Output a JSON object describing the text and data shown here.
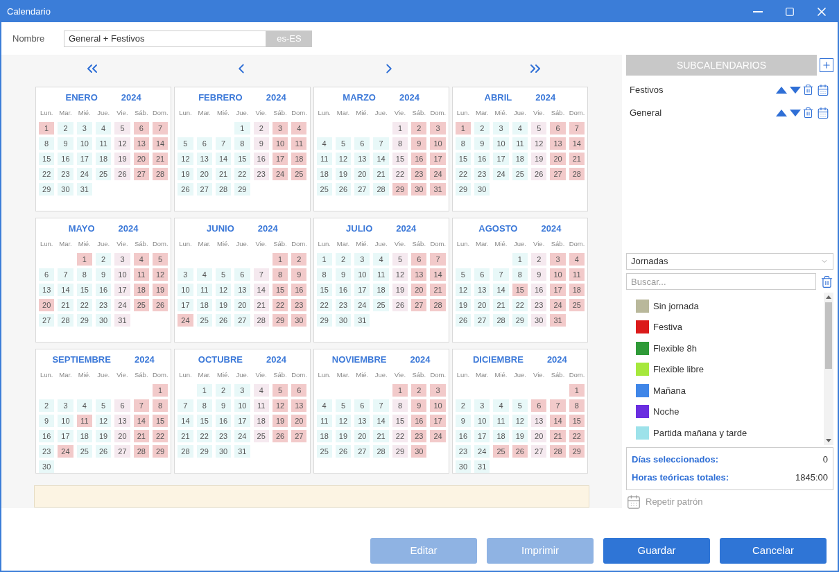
{
  "window": {
    "title": "Calendario"
  },
  "name_field": {
    "label": "Nombre",
    "value": "General + Festivos",
    "locale": "es-ES"
  },
  "months": [
    {
      "name": "ENERO",
      "year": "2024",
      "weekdays": [
        "Lun.",
        "Mar.",
        "Mié.",
        "Jue.",
        "Vie.",
        "Sáb.",
        "Dom."
      ],
      "days": [
        {
          "n": "1",
          "kind": "h"
        },
        {
          "n": "2",
          "kind": "w"
        },
        {
          "n": "3",
          "kind": "w"
        },
        {
          "n": "4",
          "kind": "w"
        },
        {
          "n": "5",
          "kind": "f"
        },
        {
          "n": "6",
          "kind": "h"
        },
        {
          "n": "7",
          "kind": "h"
        },
        {
          "n": "8",
          "kind": "w"
        },
        {
          "n": "9",
          "kind": "w"
        },
        {
          "n": "10",
          "kind": "w"
        },
        {
          "n": "11",
          "kind": "w"
        },
        {
          "n": "12",
          "kind": "f"
        },
        {
          "n": "13",
          "kind": "h"
        },
        {
          "n": "14",
          "kind": "h"
        },
        {
          "n": "15",
          "kind": "w"
        },
        {
          "n": "16",
          "kind": "w"
        },
        {
          "n": "17",
          "kind": "w"
        },
        {
          "n": "18",
          "kind": "w"
        },
        {
          "n": "19",
          "kind": "f"
        },
        {
          "n": "20",
          "kind": "h"
        },
        {
          "n": "21",
          "kind": "h"
        },
        {
          "n": "22",
          "kind": "w"
        },
        {
          "n": "23",
          "kind": "w"
        },
        {
          "n": "24",
          "kind": "w"
        },
        {
          "n": "25",
          "kind": "w"
        },
        {
          "n": "26",
          "kind": "f"
        },
        {
          "n": "27",
          "kind": "h"
        },
        {
          "n": "28",
          "kind": "h"
        },
        {
          "n": "29",
          "kind": "w"
        },
        {
          "n": "30",
          "kind": "w"
        },
        {
          "n": "31",
          "kind": "w"
        }
      ]
    },
    {
      "name": "FEBRERO",
      "year": "2024",
      "weekdays": [
        "Lun.",
        "Mar.",
        "Mié.",
        "Jue.",
        "Vie.",
        "Sáb.",
        "Dom."
      ],
      "days": [
        {
          "kind": "empty"
        },
        {
          "kind": "empty"
        },
        {
          "kind": "empty"
        },
        {
          "n": "1",
          "kind": "w"
        },
        {
          "n": "2",
          "kind": "f"
        },
        {
          "n": "3",
          "kind": "h"
        },
        {
          "n": "4",
          "kind": "h"
        },
        {
          "n": "5",
          "kind": "w"
        },
        {
          "n": "6",
          "kind": "w"
        },
        {
          "n": "7",
          "kind": "w"
        },
        {
          "n": "8",
          "kind": "w"
        },
        {
          "n": "9",
          "kind": "f"
        },
        {
          "n": "10",
          "kind": "h"
        },
        {
          "n": "11",
          "kind": "h"
        },
        {
          "n": "12",
          "kind": "w"
        },
        {
          "n": "13",
          "kind": "w"
        },
        {
          "n": "14",
          "kind": "w"
        },
        {
          "n": "15",
          "kind": "w"
        },
        {
          "n": "16",
          "kind": "f"
        },
        {
          "n": "17",
          "kind": "h"
        },
        {
          "n": "18",
          "kind": "h"
        },
        {
          "n": "19",
          "kind": "w"
        },
        {
          "n": "20",
          "kind": "w"
        },
        {
          "n": "21",
          "kind": "w"
        },
        {
          "n": "22",
          "kind": "w"
        },
        {
          "n": "23",
          "kind": "f"
        },
        {
          "n": "24",
          "kind": "h"
        },
        {
          "n": "25",
          "kind": "h"
        },
        {
          "n": "26",
          "kind": "w"
        },
        {
          "n": "27",
          "kind": "w"
        },
        {
          "n": "28",
          "kind": "w"
        },
        {
          "n": "29",
          "kind": "w"
        }
      ]
    },
    {
      "name": "MARZO",
      "year": "2024",
      "weekdays": [
        "Lun.",
        "Mar.",
        "Mié.",
        "Jue.",
        "Vie.",
        "Sáb.",
        "Dom."
      ],
      "days": [
        {
          "kind": "empty"
        },
        {
          "kind": "empty"
        },
        {
          "kind": "empty"
        },
        {
          "kind": "empty"
        },
        {
          "n": "1",
          "kind": "f"
        },
        {
          "n": "2",
          "kind": "h"
        },
        {
          "n": "3",
          "kind": "h"
        },
        {
          "n": "4",
          "kind": "w"
        },
        {
          "n": "5",
          "kind": "w"
        },
        {
          "n": "6",
          "kind": "w"
        },
        {
          "n": "7",
          "kind": "w"
        },
        {
          "n": "8",
          "kind": "f"
        },
        {
          "n": "9",
          "kind": "h"
        },
        {
          "n": "10",
          "kind": "h"
        },
        {
          "n": "11",
          "kind": "w"
        },
        {
          "n": "12",
          "kind": "w"
        },
        {
          "n": "13",
          "kind": "w"
        },
        {
          "n": "14",
          "kind": "w"
        },
        {
          "n": "15",
          "kind": "f"
        },
        {
          "n": "16",
          "kind": "h"
        },
        {
          "n": "17",
          "kind": "h"
        },
        {
          "n": "18",
          "kind": "w"
        },
        {
          "n": "19",
          "kind": "w"
        },
        {
          "n": "20",
          "kind": "w"
        },
        {
          "n": "21",
          "kind": "w"
        },
        {
          "n": "22",
          "kind": "f"
        },
        {
          "n": "23",
          "kind": "h"
        },
        {
          "n": "24",
          "kind": "h"
        },
        {
          "n": "25",
          "kind": "w"
        },
        {
          "n": "26",
          "kind": "w"
        },
        {
          "n": "27",
          "kind": "w"
        },
        {
          "n": "28",
          "kind": "w"
        },
        {
          "n": "29",
          "kind": "h"
        },
        {
          "n": "30",
          "kind": "h"
        },
        {
          "n": "31",
          "kind": "h"
        }
      ]
    },
    {
      "name": "ABRIL",
      "year": "2024",
      "weekdays": [
        "Lun.",
        "Mar.",
        "Mié.",
        "Jue.",
        "Vie.",
        "Sáb.",
        "Dom."
      ],
      "days": [
        {
          "n": "1",
          "kind": "h"
        },
        {
          "n": "2",
          "kind": "w"
        },
        {
          "n": "3",
          "kind": "w"
        },
        {
          "n": "4",
          "kind": "w"
        },
        {
          "n": "5",
          "kind": "f"
        },
        {
          "n": "6",
          "kind": "h"
        },
        {
          "n": "7",
          "kind": "h"
        },
        {
          "n": "8",
          "kind": "w"
        },
        {
          "n": "9",
          "kind": "w"
        },
        {
          "n": "10",
          "kind": "w"
        },
        {
          "n": "11",
          "kind": "w"
        },
        {
          "n": "12",
          "kind": "f"
        },
        {
          "n": "13",
          "kind": "h"
        },
        {
          "n": "14",
          "kind": "h"
        },
        {
          "n": "15",
          "kind": "w"
        },
        {
          "n": "16",
          "kind": "w"
        },
        {
          "n": "17",
          "kind": "w"
        },
        {
          "n": "18",
          "kind": "w"
        },
        {
          "n": "19",
          "kind": "f"
        },
        {
          "n": "20",
          "kind": "h"
        },
        {
          "n": "21",
          "kind": "h"
        },
        {
          "n": "22",
          "kind": "w"
        },
        {
          "n": "23",
          "kind": "w"
        },
        {
          "n": "24",
          "kind": "w"
        },
        {
          "n": "25",
          "kind": "w"
        },
        {
          "n": "26",
          "kind": "f"
        },
        {
          "n": "27",
          "kind": "h"
        },
        {
          "n": "28",
          "kind": "h"
        },
        {
          "n": "29",
          "kind": "w"
        },
        {
          "n": "30",
          "kind": "w"
        }
      ]
    },
    {
      "name": "MAYO",
      "year": "2024",
      "weekdays": [
        "Lun.",
        "Mar.",
        "Mié.",
        "Jue.",
        "Vie.",
        "Sáb.",
        "Dom."
      ],
      "days": [
        {
          "kind": "empty"
        },
        {
          "kind": "empty"
        },
        {
          "n": "1",
          "kind": "h"
        },
        {
          "n": "2",
          "kind": "w"
        },
        {
          "n": "3",
          "kind": "f"
        },
        {
          "n": "4",
          "kind": "h"
        },
        {
          "n": "5",
          "kind": "h"
        },
        {
          "n": "6",
          "kind": "w"
        },
        {
          "n": "7",
          "kind": "w"
        },
        {
          "n": "8",
          "kind": "w"
        },
        {
          "n": "9",
          "kind": "w"
        },
        {
          "n": "10",
          "kind": "f"
        },
        {
          "n": "11",
          "kind": "h"
        },
        {
          "n": "12",
          "kind": "h"
        },
        {
          "n": "13",
          "kind": "w"
        },
        {
          "n": "14",
          "kind": "w"
        },
        {
          "n": "15",
          "kind": "w"
        },
        {
          "n": "16",
          "kind": "w"
        },
        {
          "n": "17",
          "kind": "f"
        },
        {
          "n": "18",
          "kind": "h"
        },
        {
          "n": "19",
          "kind": "h"
        },
        {
          "n": "20",
          "kind": "h"
        },
        {
          "n": "21",
          "kind": "w"
        },
        {
          "n": "22",
          "kind": "w"
        },
        {
          "n": "23",
          "kind": "w"
        },
        {
          "n": "24",
          "kind": "f"
        },
        {
          "n": "25",
          "kind": "h"
        },
        {
          "n": "26",
          "kind": "h"
        },
        {
          "n": "27",
          "kind": "w"
        },
        {
          "n": "28",
          "kind": "w"
        },
        {
          "n": "29",
          "kind": "w"
        },
        {
          "n": "30",
          "kind": "w"
        },
        {
          "n": "31",
          "kind": "f"
        }
      ]
    },
    {
      "name": "JUNIO",
      "year": "2024",
      "weekdays": [
        "Lun.",
        "Mar.",
        "Mié.",
        "Jue.",
        "Vie.",
        "Sáb.",
        "Dom."
      ],
      "days": [
        {
          "kind": "empty"
        },
        {
          "kind": "empty"
        },
        {
          "kind": "empty"
        },
        {
          "kind": "empty"
        },
        {
          "kind": "empty"
        },
        {
          "n": "1",
          "kind": "h"
        },
        {
          "n": "2",
          "kind": "h"
        },
        {
          "n": "3",
          "kind": "w"
        },
        {
          "n": "4",
          "kind": "w"
        },
        {
          "n": "5",
          "kind": "w"
        },
        {
          "n": "6",
          "kind": "w"
        },
        {
          "n": "7",
          "kind": "f"
        },
        {
          "n": "8",
          "kind": "h"
        },
        {
          "n": "9",
          "kind": "h"
        },
        {
          "n": "10",
          "kind": "w"
        },
        {
          "n": "11",
          "kind": "w"
        },
        {
          "n": "12",
          "kind": "w"
        },
        {
          "n": "13",
          "kind": "w"
        },
        {
          "n": "14",
          "kind": "f"
        },
        {
          "n": "15",
          "kind": "h"
        },
        {
          "n": "16",
          "kind": "h"
        },
        {
          "n": "17",
          "kind": "w"
        },
        {
          "n": "18",
          "kind": "w"
        },
        {
          "n": "19",
          "kind": "w"
        },
        {
          "n": "20",
          "kind": "w"
        },
        {
          "n": "21",
          "kind": "f"
        },
        {
          "n": "22",
          "kind": "h"
        },
        {
          "n": "23",
          "kind": "h"
        },
        {
          "n": "24",
          "kind": "h"
        },
        {
          "n": "25",
          "kind": "w"
        },
        {
          "n": "26",
          "kind": "w"
        },
        {
          "n": "27",
          "kind": "w"
        },
        {
          "n": "28",
          "kind": "f"
        },
        {
          "n": "29",
          "kind": "h"
        },
        {
          "n": "30",
          "kind": "h"
        }
      ]
    },
    {
      "name": "JULIO",
      "year": "2024",
      "weekdays": [
        "Lun.",
        "Mar.",
        "Mié.",
        "Jue.",
        "Vie.",
        "Sáb.",
        "Dom."
      ],
      "days": [
        {
          "n": "1",
          "kind": "w"
        },
        {
          "n": "2",
          "kind": "w"
        },
        {
          "n": "3",
          "kind": "w"
        },
        {
          "n": "4",
          "kind": "w"
        },
        {
          "n": "5",
          "kind": "f"
        },
        {
          "n": "6",
          "kind": "h"
        },
        {
          "n": "7",
          "kind": "h"
        },
        {
          "n": "8",
          "kind": "w"
        },
        {
          "n": "9",
          "kind": "w"
        },
        {
          "n": "10",
          "kind": "w"
        },
        {
          "n": "11",
          "kind": "w"
        },
        {
          "n": "12",
          "kind": "f"
        },
        {
          "n": "13",
          "kind": "h"
        },
        {
          "n": "14",
          "kind": "h"
        },
        {
          "n": "15",
          "kind": "w"
        },
        {
          "n": "16",
          "kind": "w"
        },
        {
          "n": "17",
          "kind": "w"
        },
        {
          "n": "18",
          "kind": "w"
        },
        {
          "n": "19",
          "kind": "f"
        },
        {
          "n": "20",
          "kind": "h"
        },
        {
          "n": "21",
          "kind": "h"
        },
        {
          "n": "22",
          "kind": "w"
        },
        {
          "n": "23",
          "kind": "w"
        },
        {
          "n": "24",
          "kind": "w"
        },
        {
          "n": "25",
          "kind": "w"
        },
        {
          "n": "26",
          "kind": "f"
        },
        {
          "n": "27",
          "kind": "h"
        },
        {
          "n": "28",
          "kind": "h"
        },
        {
          "n": "29",
          "kind": "w"
        },
        {
          "n": "30",
          "kind": "w"
        },
        {
          "n": "31",
          "kind": "w"
        }
      ]
    },
    {
      "name": "AGOSTO",
      "year": "2024",
      "weekdays": [
        "Lun.",
        "Mar.",
        "Mié.",
        "Jue.",
        "Vie.",
        "Sáb.",
        "Dom."
      ],
      "days": [
        {
          "kind": "empty"
        },
        {
          "kind": "empty"
        },
        {
          "kind": "empty"
        },
        {
          "n": "1",
          "kind": "w"
        },
        {
          "n": "2",
          "kind": "f"
        },
        {
          "n": "3",
          "kind": "h"
        },
        {
          "n": "4",
          "kind": "h"
        },
        {
          "n": "5",
          "kind": "w"
        },
        {
          "n": "6",
          "kind": "w"
        },
        {
          "n": "7",
          "kind": "w"
        },
        {
          "n": "8",
          "kind": "w"
        },
        {
          "n": "9",
          "kind": "f"
        },
        {
          "n": "10",
          "kind": "h"
        },
        {
          "n": "11",
          "kind": "h"
        },
        {
          "n": "12",
          "kind": "w"
        },
        {
          "n": "13",
          "kind": "w"
        },
        {
          "n": "14",
          "kind": "w"
        },
        {
          "n": "15",
          "kind": "h"
        },
        {
          "n": "16",
          "kind": "f"
        },
        {
          "n": "17",
          "kind": "h"
        },
        {
          "n": "18",
          "kind": "h"
        },
        {
          "n": "19",
          "kind": "w"
        },
        {
          "n": "20",
          "kind": "w"
        },
        {
          "n": "21",
          "kind": "w"
        },
        {
          "n": "22",
          "kind": "w"
        },
        {
          "n": "23",
          "kind": "f"
        },
        {
          "n": "24",
          "kind": "h"
        },
        {
          "n": "25",
          "kind": "h"
        },
        {
          "n": "26",
          "kind": "w"
        },
        {
          "n": "27",
          "kind": "w"
        },
        {
          "n": "28",
          "kind": "w"
        },
        {
          "n": "29",
          "kind": "w"
        },
        {
          "n": "30",
          "kind": "f"
        },
        {
          "n": "31",
          "kind": "h"
        }
      ]
    },
    {
      "name": "SEPTIEMBRE",
      "year": "2024",
      "weekdays": [
        "Lun.",
        "Mar.",
        "Mié.",
        "Jue.",
        "Vie.",
        "Sáb.",
        "Dom."
      ],
      "days": [
        {
          "kind": "empty"
        },
        {
          "kind": "empty"
        },
        {
          "kind": "empty"
        },
        {
          "kind": "empty"
        },
        {
          "kind": "empty"
        },
        {
          "kind": "empty"
        },
        {
          "n": "1",
          "kind": "h"
        },
        {
          "n": "2",
          "kind": "w"
        },
        {
          "n": "3",
          "kind": "w"
        },
        {
          "n": "4",
          "kind": "w"
        },
        {
          "n": "5",
          "kind": "w"
        },
        {
          "n": "6",
          "kind": "f"
        },
        {
          "n": "7",
          "kind": "h"
        },
        {
          "n": "8",
          "kind": "h"
        },
        {
          "n": "9",
          "kind": "w"
        },
        {
          "n": "10",
          "kind": "w"
        },
        {
          "n": "11",
          "kind": "h"
        },
        {
          "n": "12",
          "kind": "w"
        },
        {
          "n": "13",
          "kind": "f"
        },
        {
          "n": "14",
          "kind": "h"
        },
        {
          "n": "15",
          "kind": "h"
        },
        {
          "n": "16",
          "kind": "w"
        },
        {
          "n": "17",
          "kind": "w"
        },
        {
          "n": "18",
          "kind": "w"
        },
        {
          "n": "19",
          "kind": "w"
        },
        {
          "n": "20",
          "kind": "f"
        },
        {
          "n": "21",
          "kind": "h"
        },
        {
          "n": "22",
          "kind": "h"
        },
        {
          "n": "23",
          "kind": "w"
        },
        {
          "n": "24",
          "kind": "h"
        },
        {
          "n": "25",
          "kind": "w"
        },
        {
          "n": "26",
          "kind": "w"
        },
        {
          "n": "27",
          "kind": "f"
        },
        {
          "n": "28",
          "kind": "h"
        },
        {
          "n": "29",
          "kind": "h"
        },
        {
          "n": "30",
          "kind": "w"
        }
      ]
    },
    {
      "name": "OCTUBRE",
      "year": "2024",
      "weekdays": [
        "Lun.",
        "Mar.",
        "Mié.",
        "Jue.",
        "Vie.",
        "Sáb.",
        "Dom."
      ],
      "days": [
        {
          "kind": "empty"
        },
        {
          "n": "1",
          "kind": "w"
        },
        {
          "n": "2",
          "kind": "w"
        },
        {
          "n": "3",
          "kind": "w"
        },
        {
          "n": "4",
          "kind": "f"
        },
        {
          "n": "5",
          "kind": "h"
        },
        {
          "n": "6",
          "kind": "h"
        },
        {
          "n": "7",
          "kind": "w"
        },
        {
          "n": "8",
          "kind": "w"
        },
        {
          "n": "9",
          "kind": "w"
        },
        {
          "n": "10",
          "kind": "w"
        },
        {
          "n": "11",
          "kind": "f"
        },
        {
          "n": "12",
          "kind": "h"
        },
        {
          "n": "13",
          "kind": "h"
        },
        {
          "n": "14",
          "kind": "w"
        },
        {
          "n": "15",
          "kind": "w"
        },
        {
          "n": "16",
          "kind": "w"
        },
        {
          "n": "17",
          "kind": "w"
        },
        {
          "n": "18",
          "kind": "f"
        },
        {
          "n": "19",
          "kind": "h"
        },
        {
          "n": "20",
          "kind": "h"
        },
        {
          "n": "21",
          "kind": "w"
        },
        {
          "n": "22",
          "kind": "w"
        },
        {
          "n": "23",
          "kind": "w"
        },
        {
          "n": "24",
          "kind": "w"
        },
        {
          "n": "25",
          "kind": "f"
        },
        {
          "n": "26",
          "kind": "h"
        },
        {
          "n": "27",
          "kind": "h"
        },
        {
          "n": "28",
          "kind": "w"
        },
        {
          "n": "29",
          "kind": "w"
        },
        {
          "n": "30",
          "kind": "w"
        },
        {
          "n": "31",
          "kind": "w"
        }
      ]
    },
    {
      "name": "NOVIEMBRE",
      "year": "2024",
      "weekdays": [
        "Lun.",
        "Mar.",
        "Mié.",
        "Jue.",
        "Vie.",
        "Sáb.",
        "Dom."
      ],
      "days": [
        {
          "kind": "empty"
        },
        {
          "kind": "empty"
        },
        {
          "kind": "empty"
        },
        {
          "kind": "empty"
        },
        {
          "n": "1",
          "kind": "h"
        },
        {
          "n": "2",
          "kind": "h"
        },
        {
          "n": "3",
          "kind": "h"
        },
        {
          "n": "4",
          "kind": "w"
        },
        {
          "n": "5",
          "kind": "w"
        },
        {
          "n": "6",
          "kind": "w"
        },
        {
          "n": "7",
          "kind": "w"
        },
        {
          "n": "8",
          "kind": "f"
        },
        {
          "n": "9",
          "kind": "h"
        },
        {
          "n": "10",
          "kind": "h"
        },
        {
          "n": "11",
          "kind": "w"
        },
        {
          "n": "12",
          "kind": "w"
        },
        {
          "n": "13",
          "kind": "w"
        },
        {
          "n": "14",
          "kind": "w"
        },
        {
          "n": "15",
          "kind": "f"
        },
        {
          "n": "16",
          "kind": "h"
        },
        {
          "n": "17",
          "kind": "h"
        },
        {
          "n": "18",
          "kind": "w"
        },
        {
          "n": "19",
          "kind": "w"
        },
        {
          "n": "20",
          "kind": "w"
        },
        {
          "n": "21",
          "kind": "w"
        },
        {
          "n": "22",
          "kind": "f"
        },
        {
          "n": "23",
          "kind": "h"
        },
        {
          "n": "24",
          "kind": "h"
        },
        {
          "n": "25",
          "kind": "w"
        },
        {
          "n": "26",
          "kind": "w"
        },
        {
          "n": "27",
          "kind": "w"
        },
        {
          "n": "28",
          "kind": "w"
        },
        {
          "n": "29",
          "kind": "f"
        },
        {
          "n": "30",
          "kind": "h"
        }
      ]
    },
    {
      "name": "DICIEMBRE",
      "year": "2024",
      "weekdays": [
        "Lun.",
        "Mar.",
        "Mié.",
        "Jue.",
        "Vie.",
        "Sáb.",
        "Dom."
      ],
      "days": [
        {
          "kind": "empty"
        },
        {
          "kind": "empty"
        },
        {
          "kind": "empty"
        },
        {
          "kind": "empty"
        },
        {
          "kind": "empty"
        },
        {
          "kind": "empty"
        },
        {
          "n": "1",
          "kind": "h"
        },
        {
          "n": "2",
          "kind": "w"
        },
        {
          "n": "3",
          "kind": "w"
        },
        {
          "n": "4",
          "kind": "w"
        },
        {
          "n": "5",
          "kind": "w"
        },
        {
          "n": "6",
          "kind": "h"
        },
        {
          "n": "7",
          "kind": "h"
        },
        {
          "n": "8",
          "kind": "h"
        },
        {
          "n": "9",
          "kind": "w"
        },
        {
          "n": "10",
          "kind": "w"
        },
        {
          "n": "11",
          "kind": "w"
        },
        {
          "n": "12",
          "kind": "w"
        },
        {
          "n": "13",
          "kind": "f"
        },
        {
          "n": "14",
          "kind": "h"
        },
        {
          "n": "15",
          "kind": "h"
        },
        {
          "n": "16",
          "kind": "w"
        },
        {
          "n": "17",
          "kind": "w"
        },
        {
          "n": "18",
          "kind": "w"
        },
        {
          "n": "19",
          "kind": "w"
        },
        {
          "n": "20",
          "kind": "f"
        },
        {
          "n": "21",
          "kind": "h"
        },
        {
          "n": "22",
          "kind": "h"
        },
        {
          "n": "23",
          "kind": "w"
        },
        {
          "n": "24",
          "kind": "w"
        },
        {
          "n": "25",
          "kind": "h"
        },
        {
          "n": "26",
          "kind": "h"
        },
        {
          "n": "27",
          "kind": "f"
        },
        {
          "n": "28",
          "kind": "h"
        },
        {
          "n": "29",
          "kind": "h"
        },
        {
          "n": "30",
          "kind": "w"
        },
        {
          "n": "31",
          "kind": "w"
        }
      ]
    }
  ],
  "subcalendars": {
    "title": "SUBCALENDARIOS",
    "items": [
      {
        "name": "Festivos"
      },
      {
        "name": "General"
      }
    ]
  },
  "jornadas": {
    "select": "Jornadas",
    "search_placeholder": "Buscar...",
    "items": [
      {
        "name": "Sin jornada",
        "color": "#b9b89b"
      },
      {
        "name": "Festiva",
        "color": "#db1a1a"
      },
      {
        "name": "Flexible 8h",
        "color": "#2f9a38"
      },
      {
        "name": "Flexible libre",
        "color": "#a6e83c"
      },
      {
        "name": "Mañana",
        "color": "#3f86e8"
      },
      {
        "name": "Noche",
        "color": "#6a2ee0"
      },
      {
        "name": "Partida mañana y tarde",
        "color": "#9de2ea"
      }
    ]
  },
  "stats": [
    {
      "label": "Días seleccionados:",
      "value": "0"
    },
    {
      "label": "Horas teóricas totales:",
      "value": "1845:00"
    }
  ],
  "repeat_pattern": {
    "label": "Repetir patrón",
    "disabled": true
  },
  "buttons": [
    {
      "label": "Editar",
      "disabled": true
    },
    {
      "label": "Imprimir",
      "disabled": true
    },
    {
      "label": "Guardar",
      "disabled": false
    },
    {
      "label": "Cancelar",
      "disabled": false
    }
  ]
}
